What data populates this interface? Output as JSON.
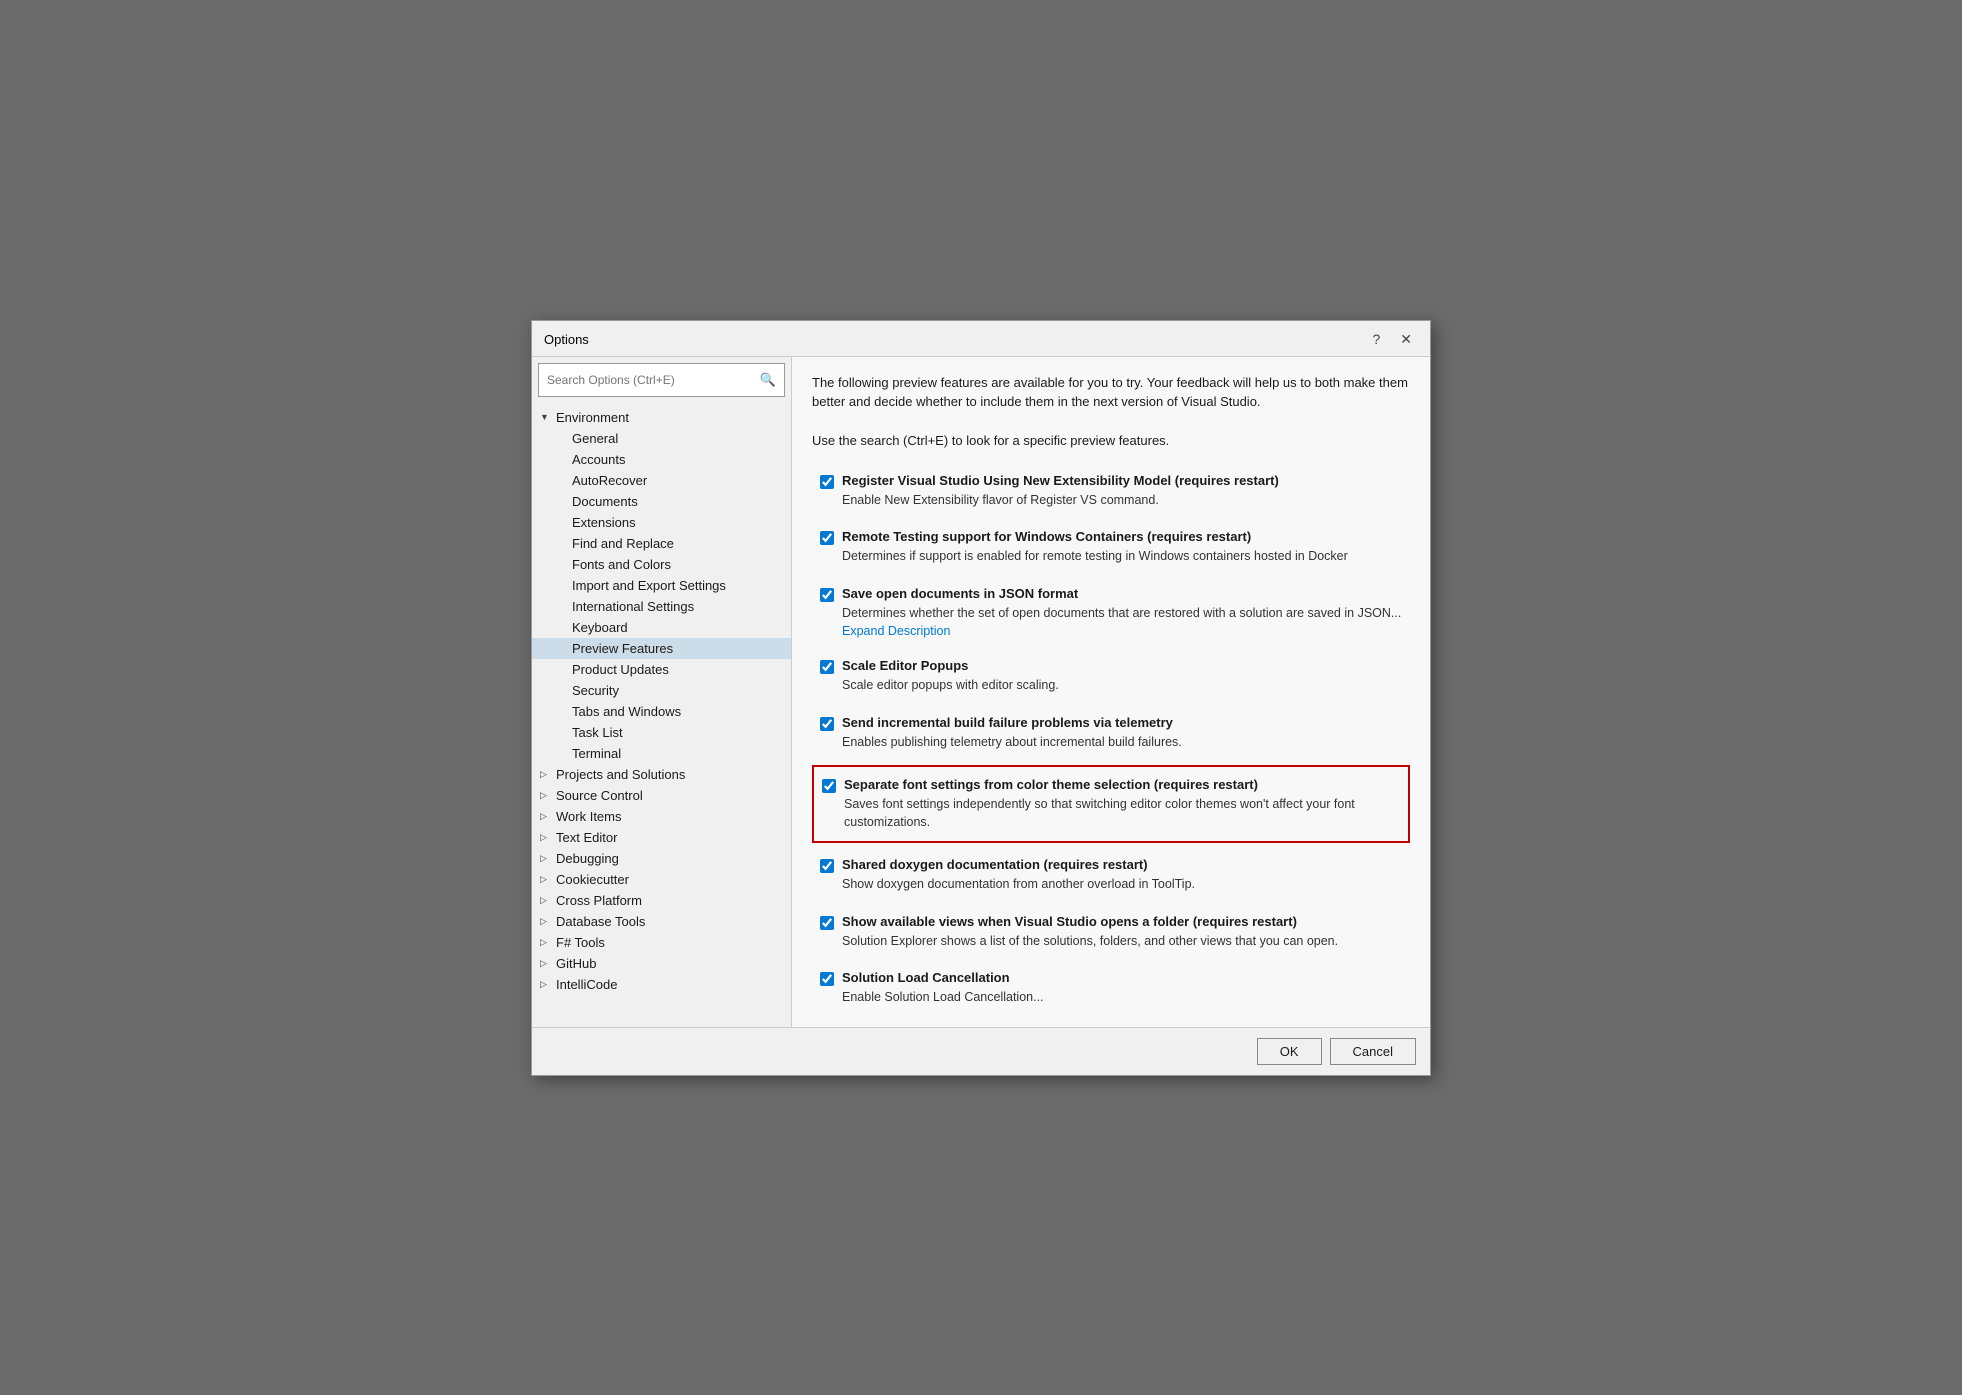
{
  "dialog": {
    "title": "Options",
    "help_btn": "?",
    "close_btn": "✕"
  },
  "search": {
    "placeholder": "Search Options (Ctrl+E)",
    "icon": "🔍"
  },
  "tree": {
    "items": [
      {
        "id": "environment",
        "label": "Environment",
        "level": 0,
        "arrow": "▼",
        "expandable": true
      },
      {
        "id": "general",
        "label": "General",
        "level": 1,
        "arrow": ""
      },
      {
        "id": "accounts",
        "label": "Accounts",
        "level": 1,
        "arrow": ""
      },
      {
        "id": "autorecover",
        "label": "AutoRecover",
        "level": 1,
        "arrow": ""
      },
      {
        "id": "documents",
        "label": "Documents",
        "level": 1,
        "arrow": ""
      },
      {
        "id": "extensions",
        "label": "Extensions",
        "level": 1,
        "arrow": ""
      },
      {
        "id": "find-replace",
        "label": "Find and Replace",
        "level": 1,
        "arrow": ""
      },
      {
        "id": "fonts-colors",
        "label": "Fonts and Colors",
        "level": 1,
        "arrow": ""
      },
      {
        "id": "import-export",
        "label": "Import and Export Settings",
        "level": 1,
        "arrow": ""
      },
      {
        "id": "international",
        "label": "International Settings",
        "level": 1,
        "arrow": ""
      },
      {
        "id": "keyboard",
        "label": "Keyboard",
        "level": 1,
        "arrow": ""
      },
      {
        "id": "preview-features",
        "label": "Preview Features",
        "level": 1,
        "arrow": "",
        "selected": true
      },
      {
        "id": "product-updates",
        "label": "Product Updates",
        "level": 1,
        "arrow": ""
      },
      {
        "id": "security",
        "label": "Security",
        "level": 1,
        "arrow": ""
      },
      {
        "id": "tabs-windows",
        "label": "Tabs and Windows",
        "level": 1,
        "arrow": ""
      },
      {
        "id": "task-list",
        "label": "Task List",
        "level": 1,
        "arrow": ""
      },
      {
        "id": "terminal",
        "label": "Terminal",
        "level": 1,
        "arrow": ""
      },
      {
        "id": "projects-solutions",
        "label": "Projects and Solutions",
        "level": 0,
        "arrow": "▷",
        "expandable": true
      },
      {
        "id": "source-control",
        "label": "Source Control",
        "level": 0,
        "arrow": "▷",
        "expandable": true
      },
      {
        "id": "work-items",
        "label": "Work Items",
        "level": 0,
        "arrow": "▷",
        "expandable": true
      },
      {
        "id": "text-editor",
        "label": "Text Editor",
        "level": 0,
        "arrow": "▷",
        "expandable": true
      },
      {
        "id": "debugging",
        "label": "Debugging",
        "level": 0,
        "arrow": "▷",
        "expandable": true
      },
      {
        "id": "cookiecutter",
        "label": "Cookiecutter",
        "level": 0,
        "arrow": "▷",
        "expandable": true
      },
      {
        "id": "cross-platform",
        "label": "Cross Platform",
        "level": 0,
        "arrow": "▷",
        "expandable": true
      },
      {
        "id": "database-tools",
        "label": "Database Tools",
        "level": 0,
        "arrow": "▷",
        "expandable": true
      },
      {
        "id": "fsharp-tools",
        "label": "F# Tools",
        "level": 0,
        "arrow": "▷",
        "expandable": true
      },
      {
        "id": "github",
        "label": "GitHub",
        "level": 0,
        "arrow": "▷",
        "expandable": true
      },
      {
        "id": "intellicode",
        "label": "IntelliCode",
        "level": 0,
        "arrow": "▷",
        "expandable": true
      }
    ]
  },
  "content": {
    "intro_line1": "The following preview features are available for you to try. Your feedback will help us to both make them better and decide whether to include them in the next version of Visual Studio.",
    "intro_line2": "Use the search (Ctrl+E) to look for a specific preview features.",
    "features": [
      {
        "id": "register-vs",
        "checked": true,
        "title": "Register Visual Studio Using New Extensibility Model (requires restart)",
        "description": "Enable New Extensibility flavor of Register VS command.",
        "expand_link": null,
        "highlighted": false
      },
      {
        "id": "remote-testing",
        "checked": true,
        "title": "Remote Testing support for Windows Containers (requires restart)",
        "description": "Determines if support is enabled for remote testing in Windows containers hosted in Docker",
        "expand_link": null,
        "highlighted": false
      },
      {
        "id": "save-json",
        "checked": true,
        "title": "Save open documents in JSON format",
        "description": "Determines whether the set of open documents that are restored with a solution are saved in JSON...",
        "expand_link": "Expand Description",
        "highlighted": false
      },
      {
        "id": "scale-editor",
        "checked": true,
        "title": "Scale Editor Popups",
        "description": "Scale editor popups with editor scaling.",
        "expand_link": null,
        "highlighted": false
      },
      {
        "id": "incremental-build",
        "checked": true,
        "title": "Send incremental build failure problems via telemetry",
        "description": "Enables publishing telemetry about incremental build failures.",
        "expand_link": null,
        "highlighted": false
      },
      {
        "id": "separate-font",
        "checked": true,
        "title": "Separate font settings from color theme selection (requires restart)",
        "description": "Saves font settings independently so that switching editor color themes won't affect your font customizations.",
        "expand_link": null,
        "highlighted": true
      },
      {
        "id": "shared-doxygen",
        "checked": true,
        "title": "Shared doxygen documentation (requires restart)",
        "description": "Show doxygen documentation from another overload in ToolTip.",
        "expand_link": null,
        "highlighted": false
      },
      {
        "id": "show-views",
        "checked": true,
        "title": "Show available views when Visual Studio opens a folder (requires restart)",
        "description": "Solution Explorer shows a list of the solutions, folders, and other views that you can open.",
        "expand_link": null,
        "highlighted": false
      },
      {
        "id": "solution-load",
        "checked": true,
        "title": "Solution Load Cancellation",
        "description": "Enable Solution Load Cancellation...",
        "expand_link": null,
        "highlighted": false
      }
    ]
  },
  "footer": {
    "ok_label": "OK",
    "cancel_label": "Cancel"
  }
}
